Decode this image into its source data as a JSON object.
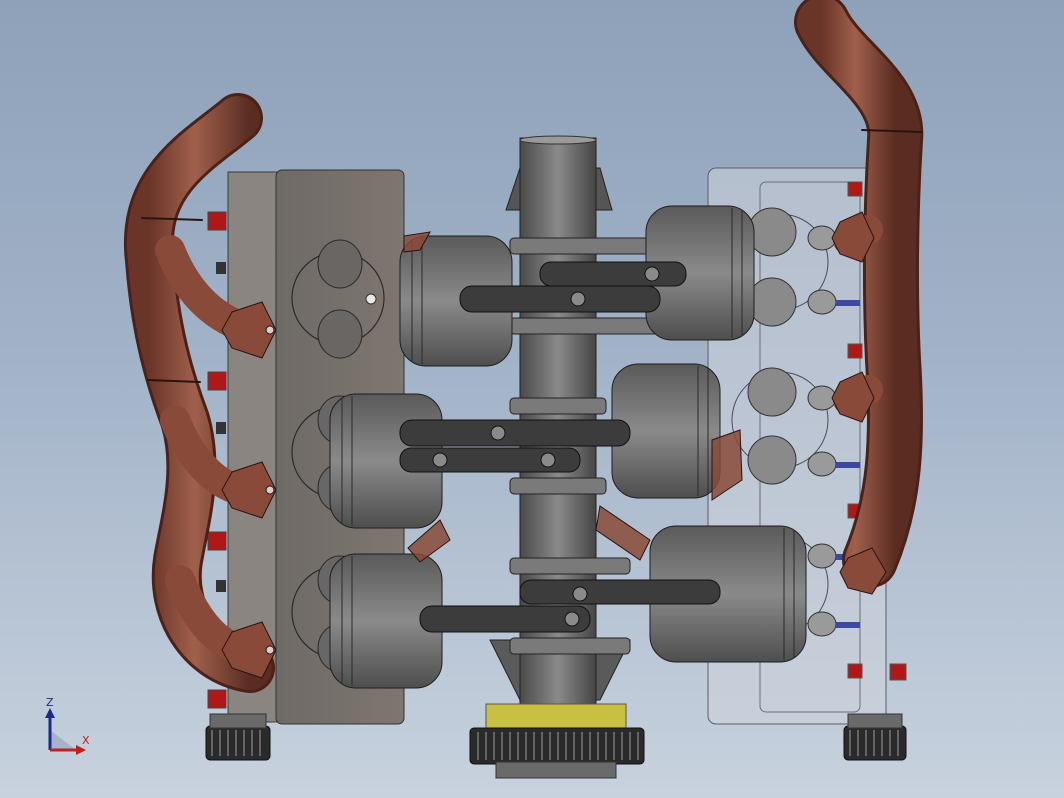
{
  "axes": {
    "z_label": "Z",
    "x_label": "X"
  },
  "colors": {
    "background_top": "#8ea1b9",
    "background_bottom": "#c8d2de",
    "exhaust": "#8a4a3a",
    "piston": "#6a6a6a",
    "connecting_rod": "#3c3c3c",
    "block": "#7a7470",
    "transparent_head": "#cdd2da",
    "timing_gear": "#c8c040",
    "bolt_red": "#a01818",
    "axis_z": "#1a2a8a",
    "axis_x": "#c02020"
  }
}
